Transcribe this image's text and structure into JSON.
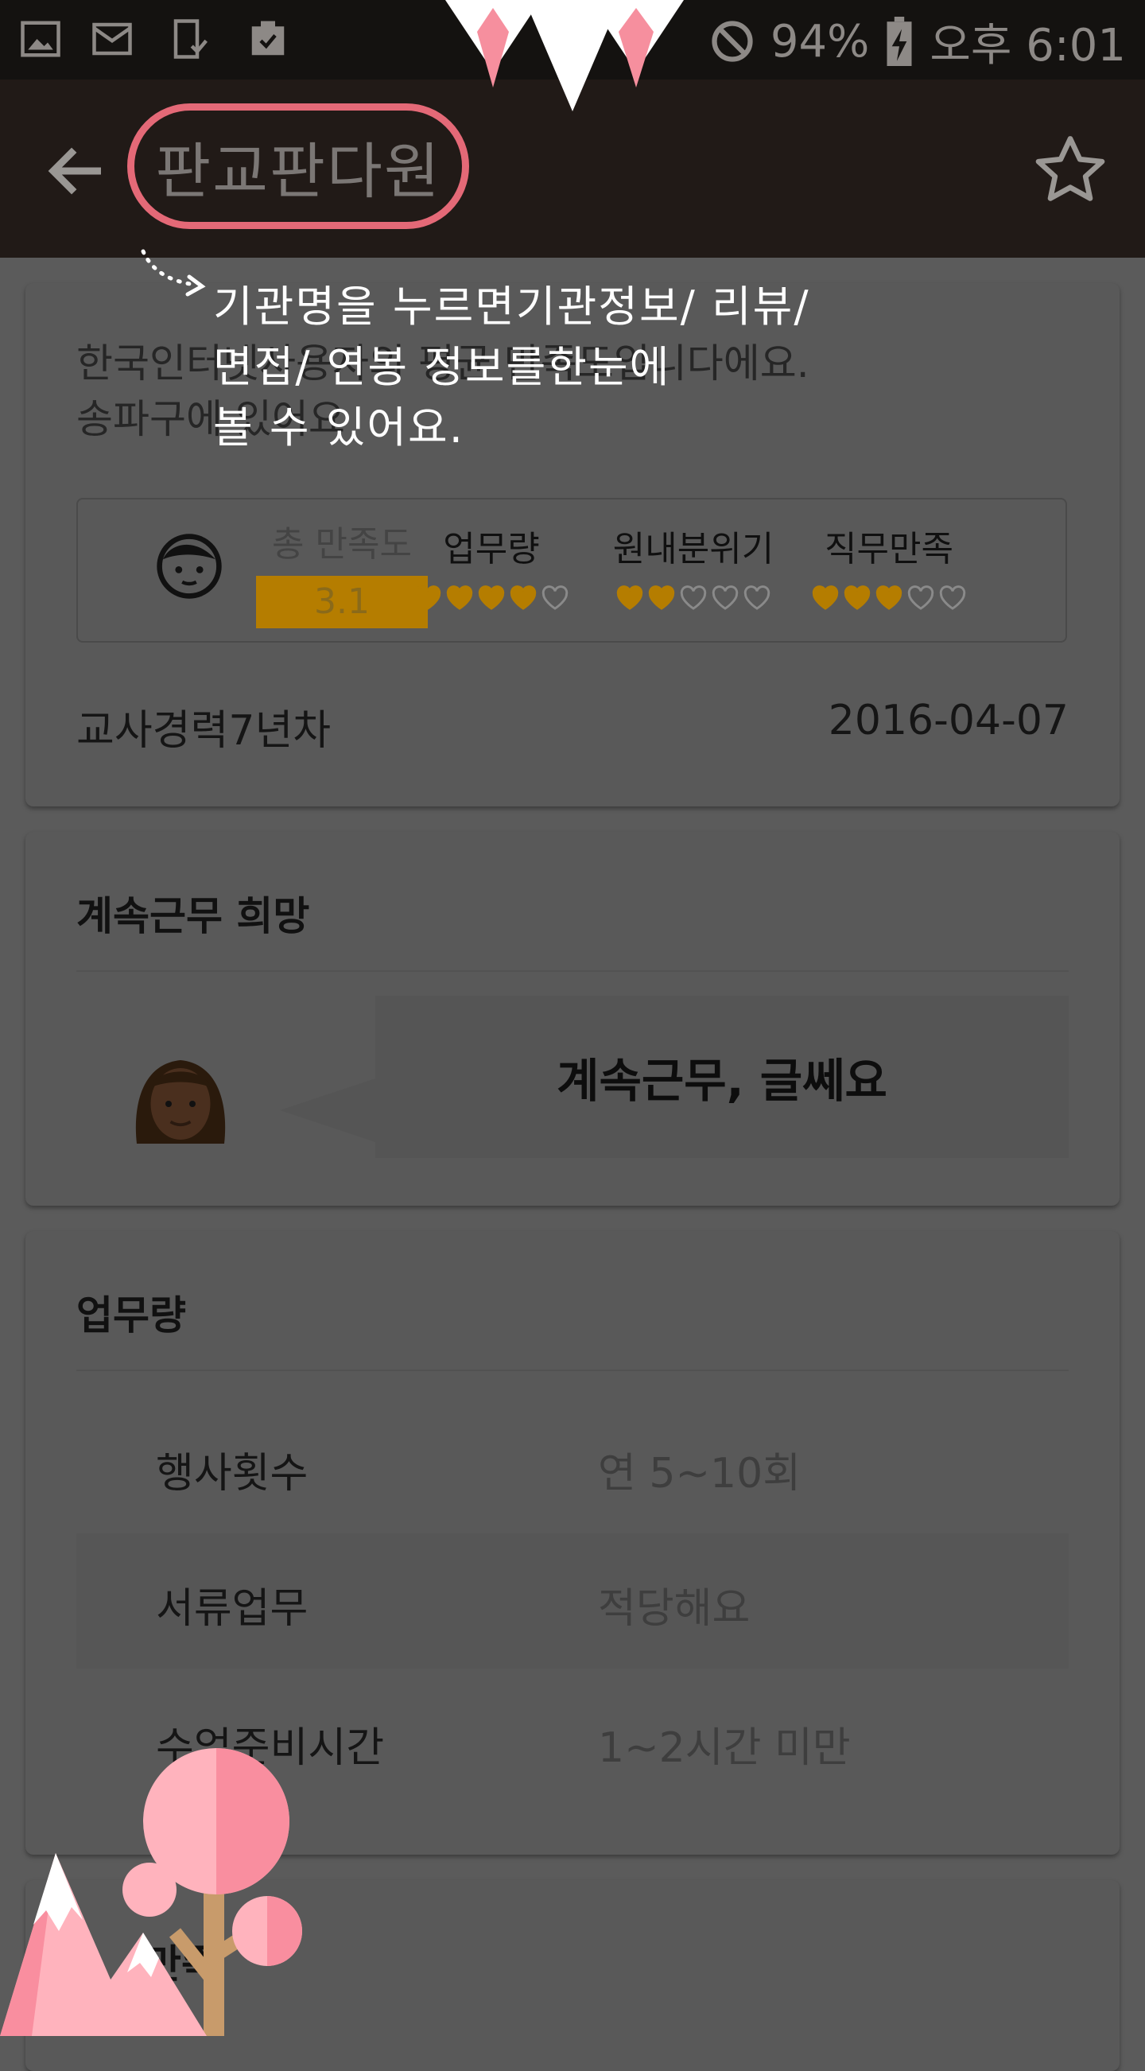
{
  "status_bar": {
    "battery": "94%",
    "time": "오후 6:01"
  },
  "app_bar": {
    "title": "판교판다원"
  },
  "annotation": {
    "text_line1": "기관명을 누르면기관정보/ 리뷰/",
    "text_line2": "면접/ 연봉 정보를한눈에",
    "text_line3": "볼 수 있어요."
  },
  "review_card": {
    "intro_line1": "한국인터넷사용자의 평균 만족도입니다에요.",
    "intro_line2": "송파구에 있어요",
    "total_label": "총 만족도",
    "total_score": "3.1",
    "metrics": [
      {
        "label": "업무량",
        "rating": 4,
        "max": 5
      },
      {
        "label": "원내분위기",
        "rating": 2,
        "max": 5
      },
      {
        "label": "직무만족",
        "rating": 3,
        "max": 5
      }
    ],
    "author": "교사경력7년차",
    "date": "2016-04-07"
  },
  "continue_card": {
    "title": "계속근무 희망",
    "answer": "계속근무, 글쎄요"
  },
  "workload_card": {
    "title": "업무량",
    "rows": [
      {
        "key": "행사횟수",
        "value": "연 5~10회"
      },
      {
        "key": "서류업무",
        "value": "적당해요"
      },
      {
        "key": "수업준비시간",
        "value": "1~2시간 미만"
      }
    ]
  },
  "next_card": {
    "title": "만족"
  },
  "colors": {
    "accent_ring": "#e46977",
    "heart_gold": "#b57d00",
    "appbar": "#211a17"
  }
}
